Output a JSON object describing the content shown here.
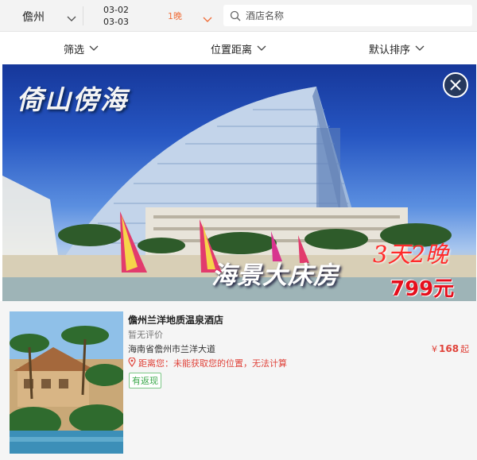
{
  "search_bar": {
    "city": "儋州",
    "check_in": "03-02",
    "check_out": "03-03",
    "nights": "1晚",
    "search_placeholder": "酒店名称"
  },
  "filters": [
    {
      "label": "筛选"
    },
    {
      "label": "位置距离"
    },
    {
      "label": "默认排序"
    }
  ],
  "banner": {
    "title": "倚山傍海",
    "room_text": "海景大床房",
    "nights_text": "3天2晚",
    "price_text": "799元"
  },
  "listing": {
    "name": "儋州兰洋地质温泉酒店",
    "rating": "暂无评价",
    "address": "海南省儋州市兰洋大道",
    "distance": "距离您：未能获取您的位置，无法计算",
    "badge": "有返现",
    "price_currency": "¥",
    "price_value": "168",
    "price_suffix": "起"
  },
  "colors": {
    "accent_orange": "#f0703c",
    "price_red": "#e0433a",
    "badge_green": "#3ba84a",
    "topbar_bg": "#f3f3f3"
  },
  "icons": [
    "chevron-down-icon",
    "search-icon",
    "close-icon",
    "location-pin-icon"
  ]
}
